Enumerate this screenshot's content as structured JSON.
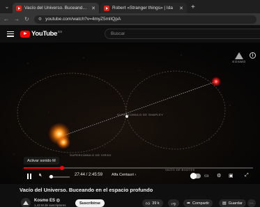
{
  "browser": {
    "tabs": [
      {
        "title": "Vacío del Universo. Buceando e",
        "active": true
      },
      {
        "title": "Robert «Stranger things» | Ida",
        "active": false
      }
    ],
    "url": "youtube.com/watch?v=4myZ5mlIQpA"
  },
  "youtube": {
    "logo_text": "YouTube",
    "country_code": "ES",
    "search_placeholder": "Buscar"
  },
  "video": {
    "watermark": "KOSMO",
    "space_labels": [
      "SUPERCÚMULO DE VIRGO",
      "SUPERCÚMULO DE SHAPLEY",
      "VACÍO DE BOOTES"
    ],
    "tooltip": "Activar sonido  M",
    "time": "27:44 / 2:45:59",
    "progress": 0.168,
    "chapter": "Alfa Centauri",
    "chapter_arrow": "›",
    "title": "Vacío del Universo. Buceando en el espacio profundo"
  },
  "channel": {
    "name": "Kosmo ES",
    "verified": "◎",
    "subscribers": "1,43 M de suscriptores",
    "subscribe_label": "Suscribirse",
    "likes": "39 k",
    "share_label": "Compartir",
    "save_label": "Guardar",
    "more_label": "···"
  },
  "colors": {
    "youtube_red": "#ff0000",
    "background": "#0f0f0f",
    "star_orange": "#ff8a1a",
    "star_red": "#ff2020"
  }
}
